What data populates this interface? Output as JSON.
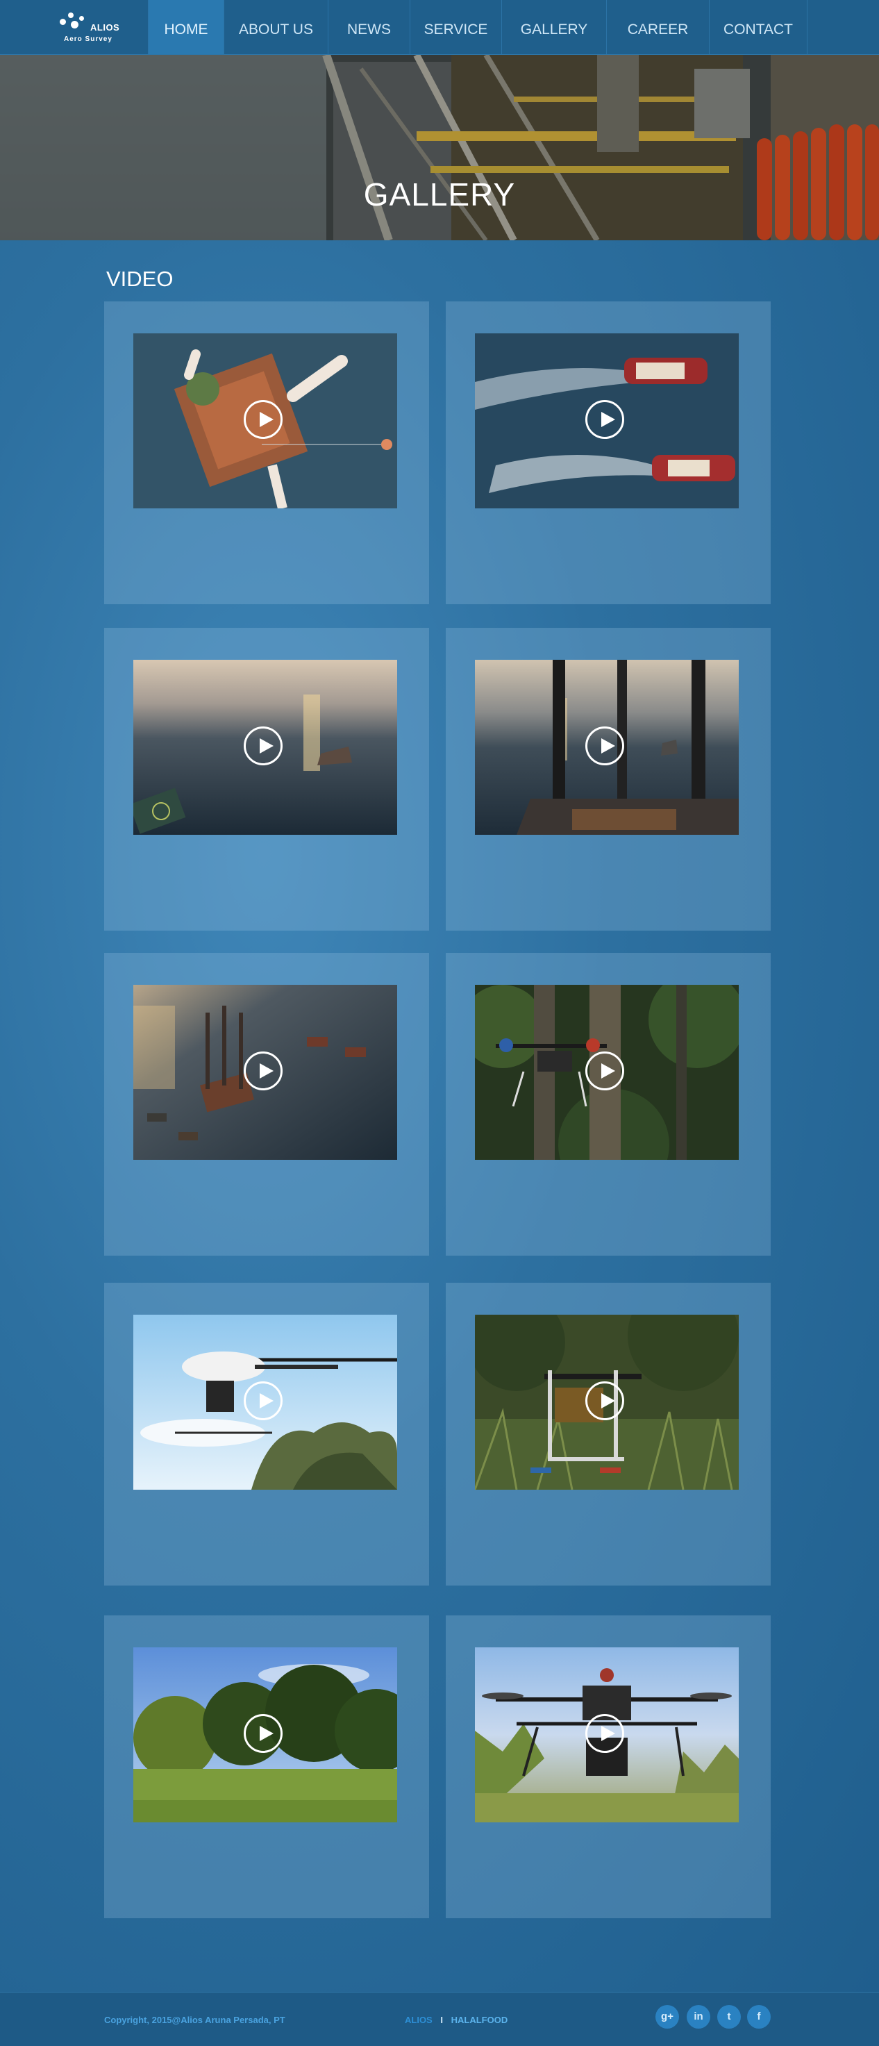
{
  "logo": {
    "brand": "ALIOS",
    "sub": "Aero Survey"
  },
  "nav": [
    {
      "label": "HOME",
      "active": true
    },
    {
      "label": "ABOUT US",
      "active": false
    },
    {
      "label": "NEWS",
      "active": false
    },
    {
      "label": "SERVICE",
      "active": false
    },
    {
      "label": "GALLERY",
      "active": false
    },
    {
      "label": "CAREER",
      "active": false
    },
    {
      "label": "CONTACT",
      "active": false
    }
  ],
  "hero": {
    "title": "GALLERY"
  },
  "gallery": {
    "section_title": "VIDEO",
    "videos": [
      {
        "scene": "offshore-rig-top-view",
        "play_icon": "play-icon"
      },
      {
        "scene": "two-tugboats-wake",
        "play_icon": "play-icon"
      },
      {
        "scene": "sunset-sea-boat",
        "play_icon": "play-icon"
      },
      {
        "scene": "rig-legs-sunset",
        "play_icon": "play-icon"
      },
      {
        "scene": "jackup-barge-boats",
        "play_icon": "play-icon"
      },
      {
        "scene": "drone-in-forest",
        "play_icon": "play-icon"
      },
      {
        "scene": "helicopter-drone-sky",
        "play_icon": "play-icon"
      },
      {
        "scene": "drone-grass-field",
        "play_icon": "play-icon"
      },
      {
        "scene": "green-hill-trees",
        "play_icon": "play-icon"
      },
      {
        "scene": "hexacopter-flying",
        "play_icon": "play-icon"
      }
    ]
  },
  "footer": {
    "copyright": "Copyright, 2015@Alios Aruna Persada, PT",
    "link1": "ALIOS",
    "separator": "I",
    "link2": "HALALFOOD",
    "social": [
      {
        "icon": "google-plus-icon",
        "glyph": "g+"
      },
      {
        "icon": "linkedin-icon",
        "glyph": "in"
      },
      {
        "icon": "twitter-icon",
        "glyph": "t"
      },
      {
        "icon": "facebook-icon",
        "glyph": "f"
      }
    ]
  }
}
